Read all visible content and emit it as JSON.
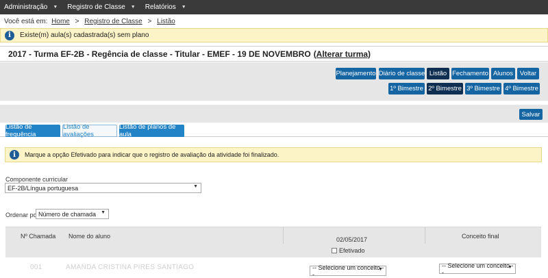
{
  "nav": {
    "items": [
      {
        "label": "Administração"
      },
      {
        "label": "Registro de Classe"
      },
      {
        "label": "Relatórios"
      }
    ]
  },
  "breadcrumb": {
    "prefix": "Você está em:",
    "items": [
      "Home",
      "Registro de Classe",
      "Listão"
    ],
    "separator": ">"
  },
  "alert": {
    "message": "Existe(m) aula(s) cadastrada(s) sem plano"
  },
  "title": {
    "text": "2017 - Turma EF-2B - Regência de classe - Titular - EMEF - 19 DE NOVEMBRO",
    "change_link": "(Alterar turma)"
  },
  "toolbar": {
    "buttons": [
      "Planejamento",
      "Diário de classe",
      "Listão",
      "Fechamento",
      "Alunos",
      "Voltar"
    ],
    "bimesters": [
      "1º Bimestre",
      "2º Bimestre",
      "3º Bimestre",
      "4º Bimestre"
    ],
    "save_label": "Salvar"
  },
  "tabs": [
    "Listão de frequência",
    "Listão de avaliações",
    "Listão de planos de aula"
  ],
  "note": {
    "message": "Marque a opção Efetivado para indicar que o registro de avaliação da atividade foi finalizado."
  },
  "filters": {
    "component_label": "Componente curricular",
    "component_value": "EF-2B/Língua portuguesa",
    "order_label": "Ordenar por:",
    "order_value": "Número de chamada"
  },
  "grid": {
    "col_number": "Nº Chamada",
    "col_name": "Nome do aluno",
    "col_date": "02/05/2017",
    "col_final": "Conceito final",
    "efetivado_label": "Efetivado",
    "row_select_placeholder": "-- Selecione um conceito --",
    "row_number": "001",
    "row_name": "AMANDA CRISTINA PIRES SANTIAGO"
  }
}
